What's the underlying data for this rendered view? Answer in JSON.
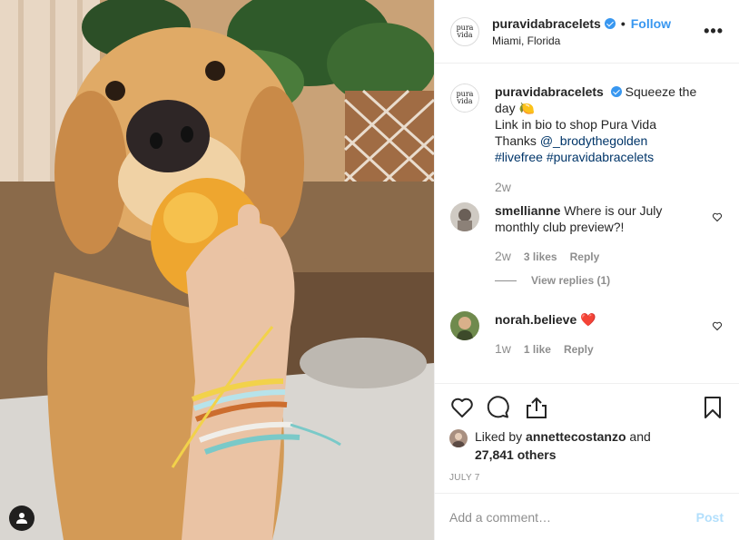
{
  "header": {
    "avatar_text_top": "pura",
    "avatar_text_bottom": "vida",
    "username": "puravidabracelets",
    "separator": "•",
    "follow_label": "Follow",
    "location": "Miami, Florida",
    "more_icon": "more-horizontal-icon"
  },
  "caption": {
    "username": "puravidabracelets",
    "text_line1": "Squeeze the day",
    "emoji": "🍋",
    "text_line2": "Link in bio to shop Pura Vida",
    "text_line3_prefix": "Thanks",
    "mention": "@_brodythegolden",
    "hashtag1": "#livefree",
    "hashtag2": "#puravidabracelets",
    "time": "2w"
  },
  "comments": [
    {
      "username": "smellianne",
      "text": "Where is our July monthly club preview?!",
      "time": "2w",
      "likes": "3 likes",
      "reply_label": "Reply",
      "view_replies": "View replies (1)"
    },
    {
      "username": "norah.believe",
      "text": "❤️",
      "time": "1w",
      "likes": "1 like",
      "reply_label": "Reply"
    }
  ],
  "likes": {
    "prefix": "Liked by",
    "user": "annettecostanzo",
    "and": "and",
    "count": "27,841 others"
  },
  "date": "JULY 7",
  "add_comment": {
    "placeholder": "Add a comment…",
    "post_label": "Post"
  },
  "colors": {
    "accent": "#3897f0",
    "post_disabled": "#b2dffc",
    "muted": "#8e8e8e",
    "border": "#efefef"
  }
}
